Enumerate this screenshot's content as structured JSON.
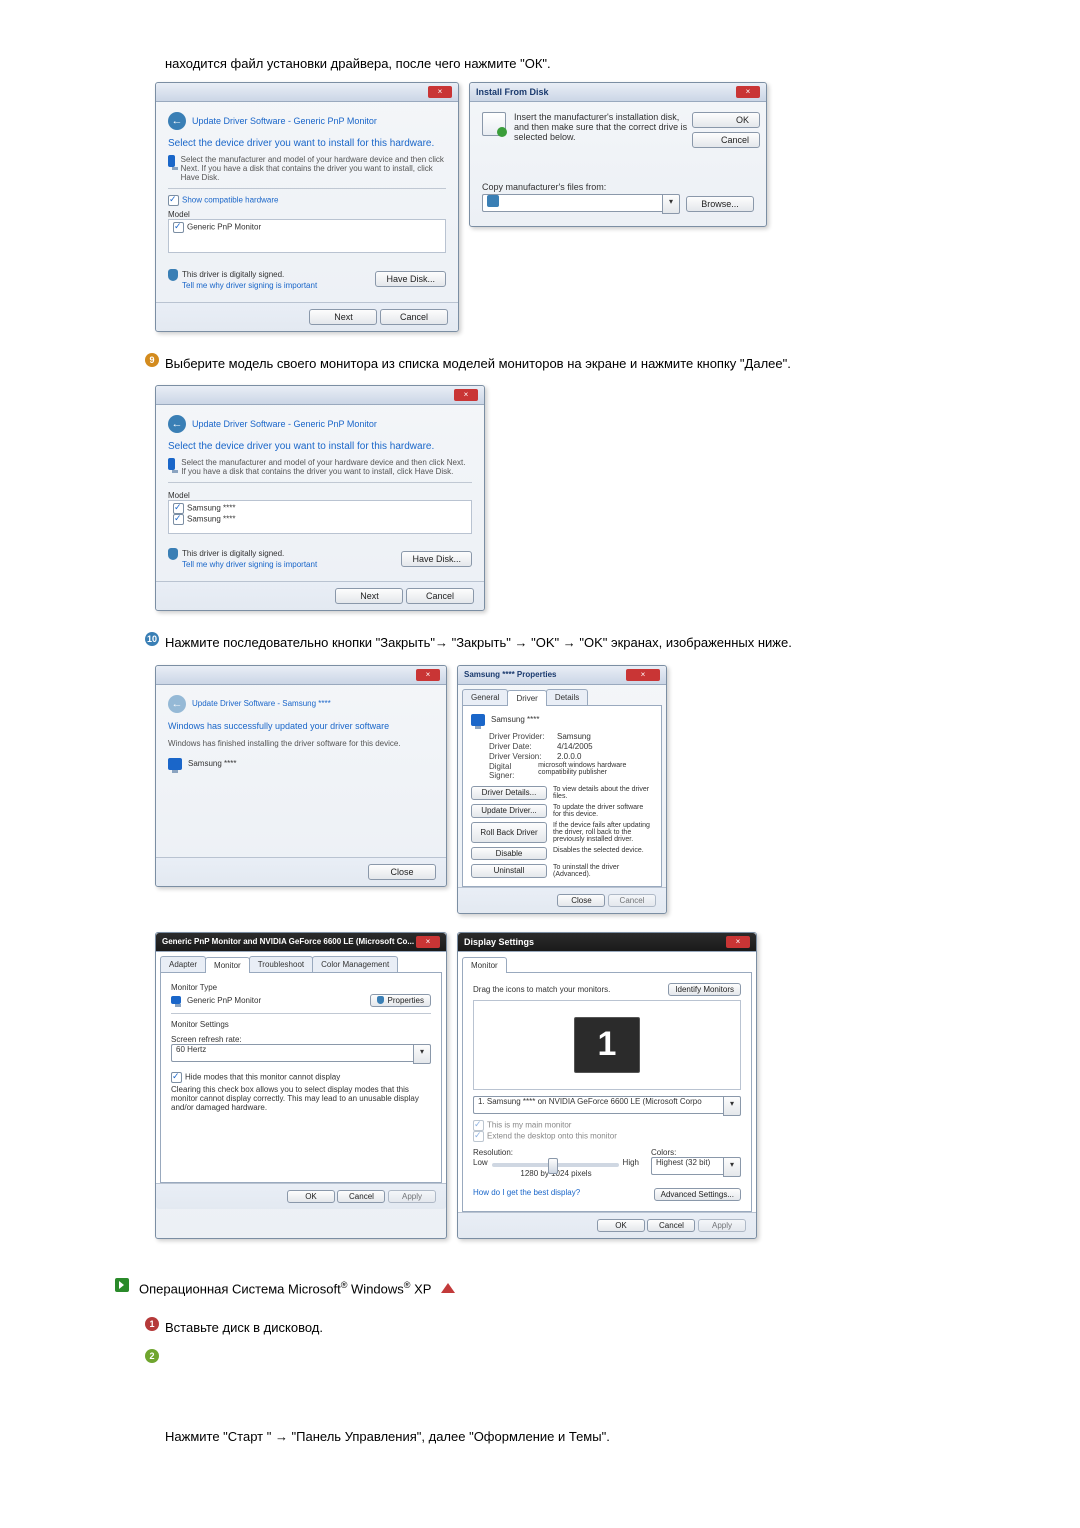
{
  "intro_step": "находится файл установки драйвера, после чего нажмите \"ОК\".",
  "step9": "Выберите модель своего монитора из списка моделей мониторов на экране и нажмите кнопку \"Далее\".",
  "step10": "Нажмите последовательно кнопки \"Закрыть\"→ \"Закрыть\" → \"OK\" → \"OK\" экранах, изображенных ниже.",
  "xp_heading": "Операционная Система Microsoft® Windows® XP",
  "xp_step1": "Вставьте диск в дисковод.",
  "xp_step2": "Нажмите \"Старт \" → \"Панель Управления\", далее \"Оформление и Темы\".",
  "dlg_update": {
    "title": "Update Driver Software - Generic PnP Monitor",
    "heading": "Select the device driver you want to install for this hardware.",
    "sub": "Select the manufacturer and model of your hardware device and then click Next. If you have a disk that contains the driver you want to install, click Have Disk.",
    "show_compat": "Show compatible hardware",
    "model_label": "Model",
    "model_item": "Generic PnP Monitor",
    "signed": "This driver is digitally signed.",
    "tell_me": "Tell me why driver signing is important",
    "have_disk": "Have Disk...",
    "next": "Next",
    "cancel": "Cancel"
  },
  "dlg_install_disk": {
    "title": "Install From Disk",
    "msg": "Insert the manufacturer's installation disk, and then make sure that the correct drive is selected below.",
    "ok": "OK",
    "cancel": "Cancel",
    "copy_from": "Copy manufacturer's files from:",
    "browse": "Browse..."
  },
  "dlg_models": {
    "title": "Update Driver Software - Generic PnP Monitor",
    "heading": "Select the device driver you want to install for this hardware.",
    "sub": "Select the manufacturer and model of your hardware device and then click Next. If you have a disk that contains the driver you want to install, click Have Disk.",
    "model_label": "Model",
    "item1": "Samsung ****",
    "item2": "Samsung ****",
    "signed": "This driver is digitally signed.",
    "tell_me": "Tell me why driver signing is important",
    "have_disk": "Have Disk...",
    "next": "Next",
    "cancel": "Cancel"
  },
  "dlg_success": {
    "title": "Update Driver Software - Samsung ****",
    "heading": "Windows has successfully updated your driver software",
    "sub": "Windows has finished installing the driver software for this device.",
    "device": "Samsung ****",
    "close": "Close"
  },
  "dlg_props": {
    "title": "Samsung **** Properties",
    "tab_general": "General",
    "tab_driver": "Driver",
    "tab_details": "Details",
    "device": "Samsung ****",
    "provider_k": "Driver Provider:",
    "provider_v": "Samsung",
    "date_k": "Driver Date:",
    "date_v": "4/14/2005",
    "version_k": "Driver Version:",
    "version_v": "2.0.0.0",
    "signer_k": "Digital Signer:",
    "signer_v": "microsoft windows hardware compatibility publisher",
    "btn_details": "Driver Details...",
    "btn_details_d": "To view details about the driver files.",
    "btn_update": "Update Driver...",
    "btn_update_d": "To update the driver software for this device.",
    "btn_rollback": "Roll Back Driver",
    "btn_rollback_d": "If the device fails after updating the driver, roll back to the previously installed driver.",
    "btn_disable": "Disable",
    "btn_disable_d": "Disables the selected device.",
    "btn_uninstall": "Uninstall",
    "btn_uninstall_d": "To uninstall the driver (Advanced).",
    "close": "Close",
    "cancel": "Cancel"
  },
  "dlg_monitor_tab": {
    "title": "Generic PnP Monitor and NVIDIA GeForce 6600 LE (Microsoft Co...",
    "tab_adapter": "Adapter",
    "tab_monitor": "Monitor",
    "tab_trouble": "Troubleshoot",
    "tab_color": "Color Management",
    "mtype": "Monitor Type",
    "mtype_val": "Generic PnP Monitor",
    "properties": "Properties",
    "msettings": "Monitor Settings",
    "refresh": "Screen refresh rate:",
    "refresh_val": "60 Hertz",
    "hide": "Hide modes that this monitor cannot display",
    "hide_note": "Clearing this check box allows you to select display modes that this monitor cannot display correctly. This may lead to an unusable display and/or damaged hardware.",
    "ok": "OK",
    "cancel": "Cancel",
    "apply": "Apply"
  },
  "dlg_display": {
    "title": "Display Settings",
    "tab_monitor": "Monitor",
    "drag": "Drag the icons to match your monitors.",
    "identify": "Identify Monitors",
    "preview_num": "1",
    "combo": "1. Samsung **** on NVIDIA GeForce 6600 LE (Microsoft Corpo",
    "main": "This is my main monitor",
    "extend": "Extend the desktop onto this monitor",
    "resolution": "Resolution:",
    "low": "Low",
    "high": "High",
    "res_val": "1280 by 1024 pixels",
    "colors": "Colors:",
    "colors_val": "Highest (32 bit)",
    "best": "How do I get the best display?",
    "advanced": "Advanced Settings...",
    "ok": "OK",
    "cancel": "Cancel",
    "apply": "Apply"
  }
}
